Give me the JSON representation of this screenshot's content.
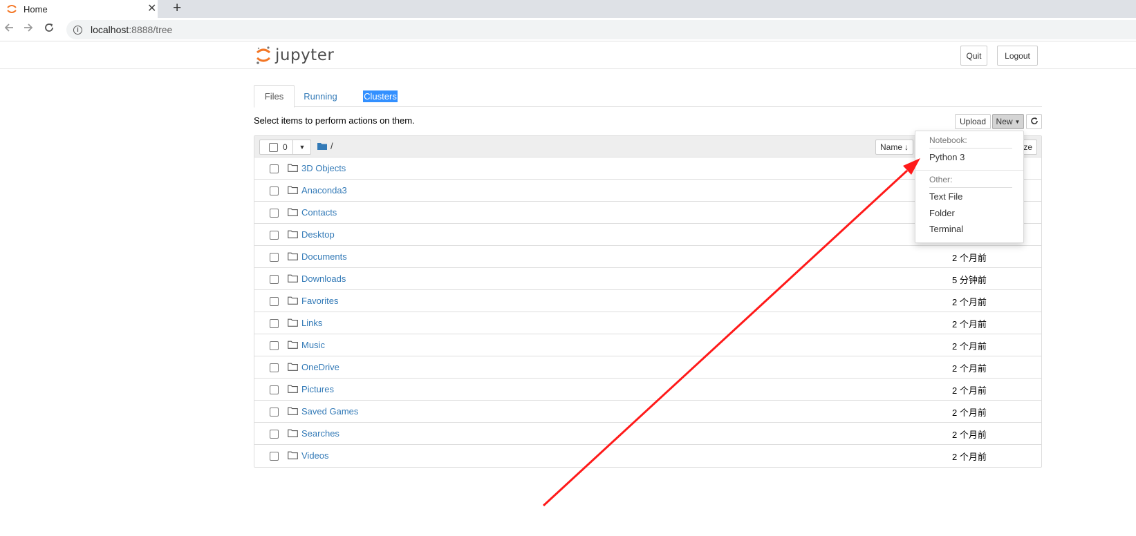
{
  "browser": {
    "tab_title": "Home",
    "close_glyph": "✕",
    "new_tab_glyph": "+",
    "url_host": "localhost",
    "url_path": ":8888/tree",
    "icons": [
      "back-arrow-icon",
      "forward-arrow-icon",
      "reload-icon",
      "info-icon"
    ]
  },
  "header": {
    "logo_text": "jupyter",
    "quit_label": "Quit",
    "logout_label": "Logout"
  },
  "tabs": {
    "files": "Files",
    "running": "Running",
    "clusters": "Clusters"
  },
  "toolbar": {
    "hint": "Select items to perform actions on them.",
    "upload_label": "Upload",
    "new_label": "New",
    "refresh_glyph": "⟳"
  },
  "list_header": {
    "selected_count": "0",
    "breadcrumb": "/",
    "name_sort_label": "Name",
    "sort_glyph": "🡓",
    "size_label": "ze"
  },
  "new_menu": {
    "notebook_header": "Notebook:",
    "python3": "Python 3",
    "other_header": "Other:",
    "text_file": "Text File",
    "folder": "Folder",
    "terminal": "Terminal"
  },
  "files": [
    {
      "name": "3D Objects",
      "modified": ""
    },
    {
      "name": "Anaconda3",
      "modified": ""
    },
    {
      "name": "Contacts",
      "modified": ""
    },
    {
      "name": "Desktop",
      "modified": ""
    },
    {
      "name": "Documents",
      "modified": "2 个月前"
    },
    {
      "name": "Downloads",
      "modified": "5 分钟前"
    },
    {
      "name": "Favorites",
      "modified": "2 个月前"
    },
    {
      "name": "Links",
      "modified": "2 个月前"
    },
    {
      "name": "Music",
      "modified": "2 个月前"
    },
    {
      "name": "OneDrive",
      "modified": "2 个月前"
    },
    {
      "name": "Pictures",
      "modified": "2 个月前"
    },
    {
      "name": "Saved Games",
      "modified": "2 个月前"
    },
    {
      "name": "Searches",
      "modified": "2 个月前"
    },
    {
      "name": "Videos",
      "modified": "2 个月前"
    }
  ],
  "colors": {
    "link": "#337ab7",
    "jupyter_orange": "#f37726",
    "annotation_red": "#ff1a1a",
    "selection_blue": "#3390ff"
  }
}
